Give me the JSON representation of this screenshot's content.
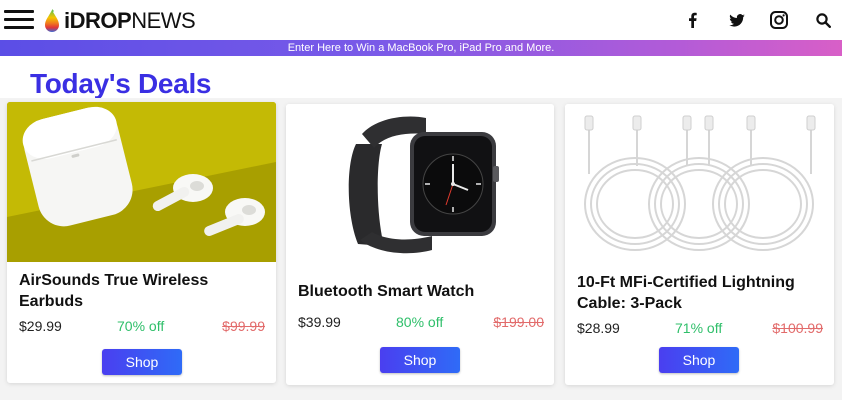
{
  "header": {
    "logo_strong": "iDROP",
    "logo_light": "NEWS",
    "social": [
      {
        "icon": "facebook-icon"
      },
      {
        "icon": "twitter-icon"
      },
      {
        "icon": "instagram-icon"
      },
      {
        "icon": "search-icon"
      }
    ]
  },
  "promo": {
    "text": "Enter Here to Win a MacBook Pro, iPad Pro and More."
  },
  "page": {
    "title": "Today's Deals"
  },
  "deals": [
    {
      "name": "AirSounds True Wireless Earbuds",
      "price": "$29.99",
      "discount": "70% off",
      "original_price": "$99.99",
      "shop_label": "Shop",
      "image": "earbuds-image"
    },
    {
      "name": "Bluetooth Smart Watch",
      "price": "$39.99",
      "discount": "80% off",
      "original_price": "$199.00",
      "shop_label": "Shop",
      "image": "smart-watch-image"
    },
    {
      "name": "10-Ft MFi-Certified Lightning Cable: 3-Pack",
      "price": "$28.99",
      "discount": "71% off",
      "original_price": "$100.99",
      "shop_label": "Shop",
      "image": "lightning-cable-image"
    }
  ],
  "colors": {
    "title": "#3a2fe3",
    "discount": "#2fbf6a",
    "original_price": "#e26b6b",
    "promo_start": "#5b4ee6",
    "promo_end": "#d85fc7"
  }
}
